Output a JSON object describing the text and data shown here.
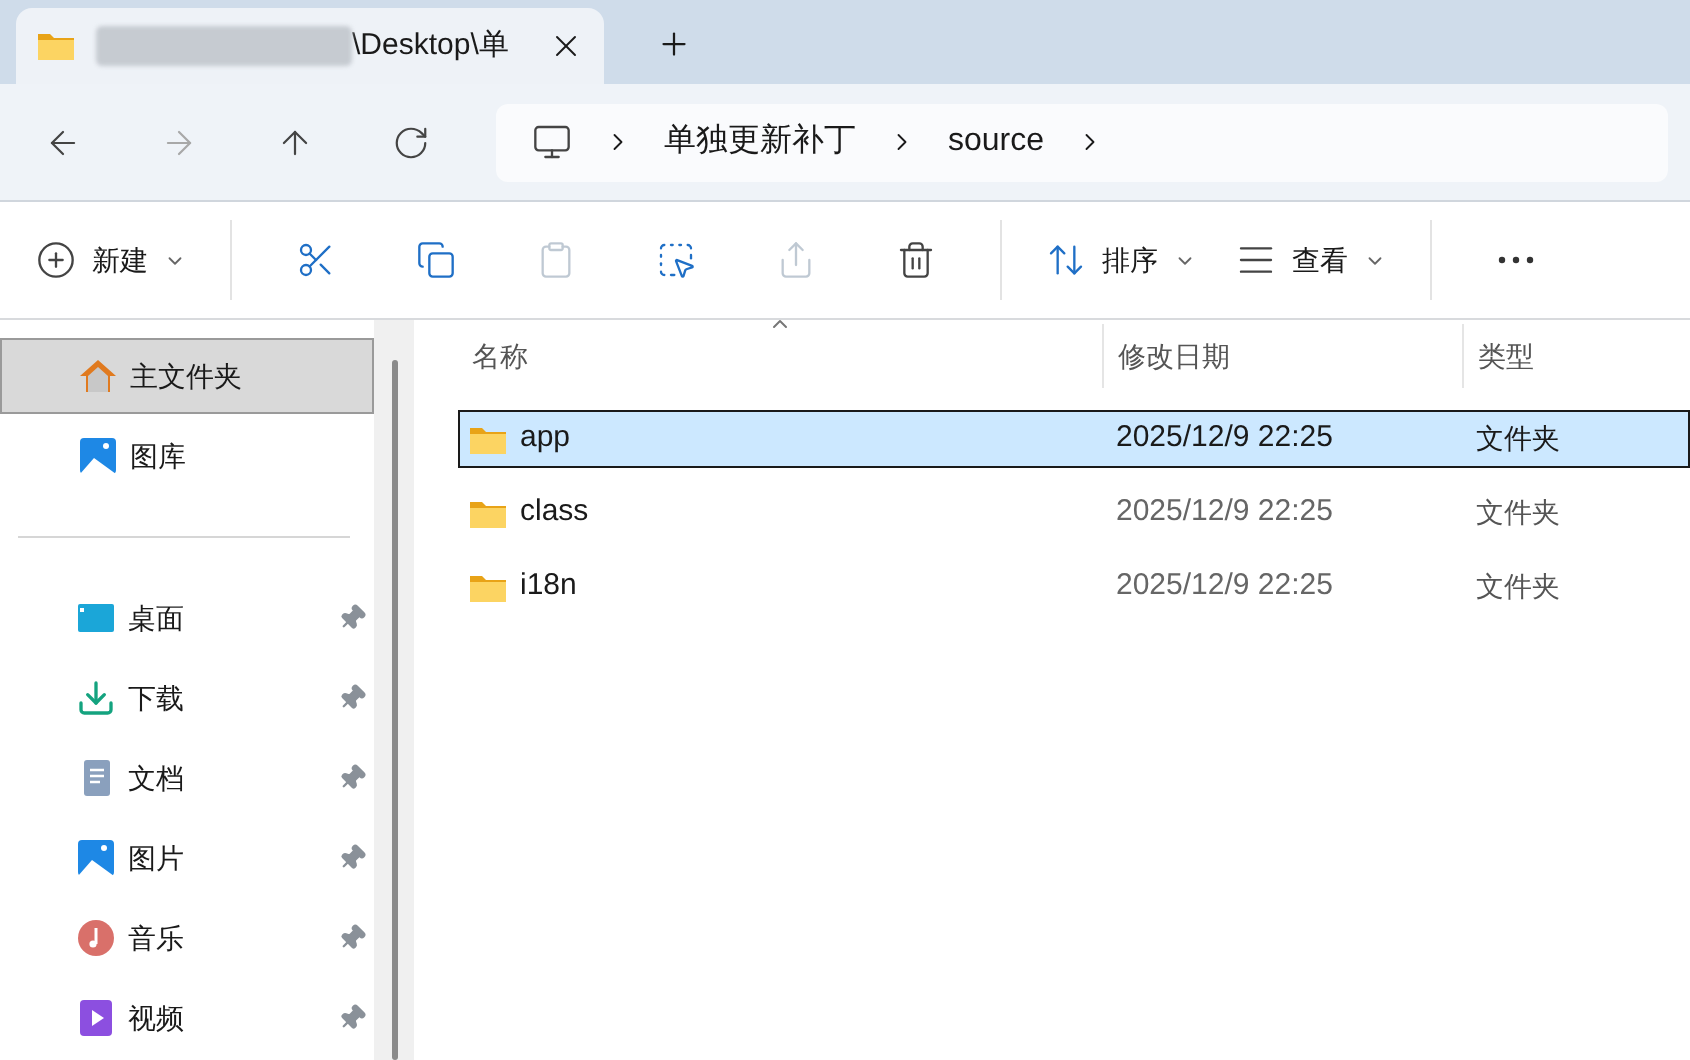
{
  "tab": {
    "title": "\\Desktop\\单"
  },
  "nav": [
    {
      "kind": "back",
      "disabled": false
    },
    {
      "kind": "forward",
      "disabled": true
    },
    {
      "kind": "up",
      "disabled": false
    },
    {
      "kind": "refresh",
      "disabled": false
    }
  ],
  "breadcrumb": [
    "单独更新补丁",
    "source"
  ],
  "toolbar": [
    {
      "kind": "new",
      "label": "新建",
      "disabled": false
    },
    {
      "kind": "cut",
      "disabled": false
    },
    {
      "kind": "copy",
      "disabled": false
    },
    {
      "kind": "paste",
      "disabled": true
    },
    {
      "kind": "rename",
      "disabled": false
    },
    {
      "kind": "share",
      "disabled": true
    },
    {
      "kind": "delete",
      "disabled": false
    },
    {
      "kind": "sort",
      "label": "排序",
      "disabled": false
    },
    {
      "kind": "view",
      "label": "查看",
      "disabled": false
    },
    {
      "kind": "more",
      "disabled": false
    }
  ],
  "sidebar": {
    "top": [
      {
        "kind": "home",
        "label": "主文件夹",
        "selected": true
      },
      {
        "kind": "gallery",
        "label": "图库",
        "selected": false
      }
    ],
    "quick": [
      {
        "kind": "desktop",
        "label": "桌面",
        "pinned": true
      },
      {
        "kind": "downloads",
        "label": "下载",
        "pinned": true
      },
      {
        "kind": "documents",
        "label": "文档",
        "pinned": true
      },
      {
        "kind": "pictures",
        "label": "图片",
        "pinned": true
      },
      {
        "kind": "music",
        "label": "音乐",
        "pinned": true
      },
      {
        "kind": "videos",
        "label": "视频",
        "pinned": true
      }
    ]
  },
  "table": {
    "columns": [
      {
        "label": "名称",
        "sorted": true
      },
      {
        "label": "修改日期",
        "sorted": false
      },
      {
        "label": "类型",
        "sorted": false
      }
    ],
    "rows": [
      {
        "name": "app",
        "modified": "2025/12/9 22:25",
        "type": "文件夹",
        "selected": true
      },
      {
        "name": "class",
        "modified": "2025/12/9 22:25",
        "type": "文件夹",
        "selected": false
      },
      {
        "name": "i18n",
        "modified": "2025/12/9 22:25",
        "type": "文件夹",
        "selected": false
      }
    ]
  }
}
